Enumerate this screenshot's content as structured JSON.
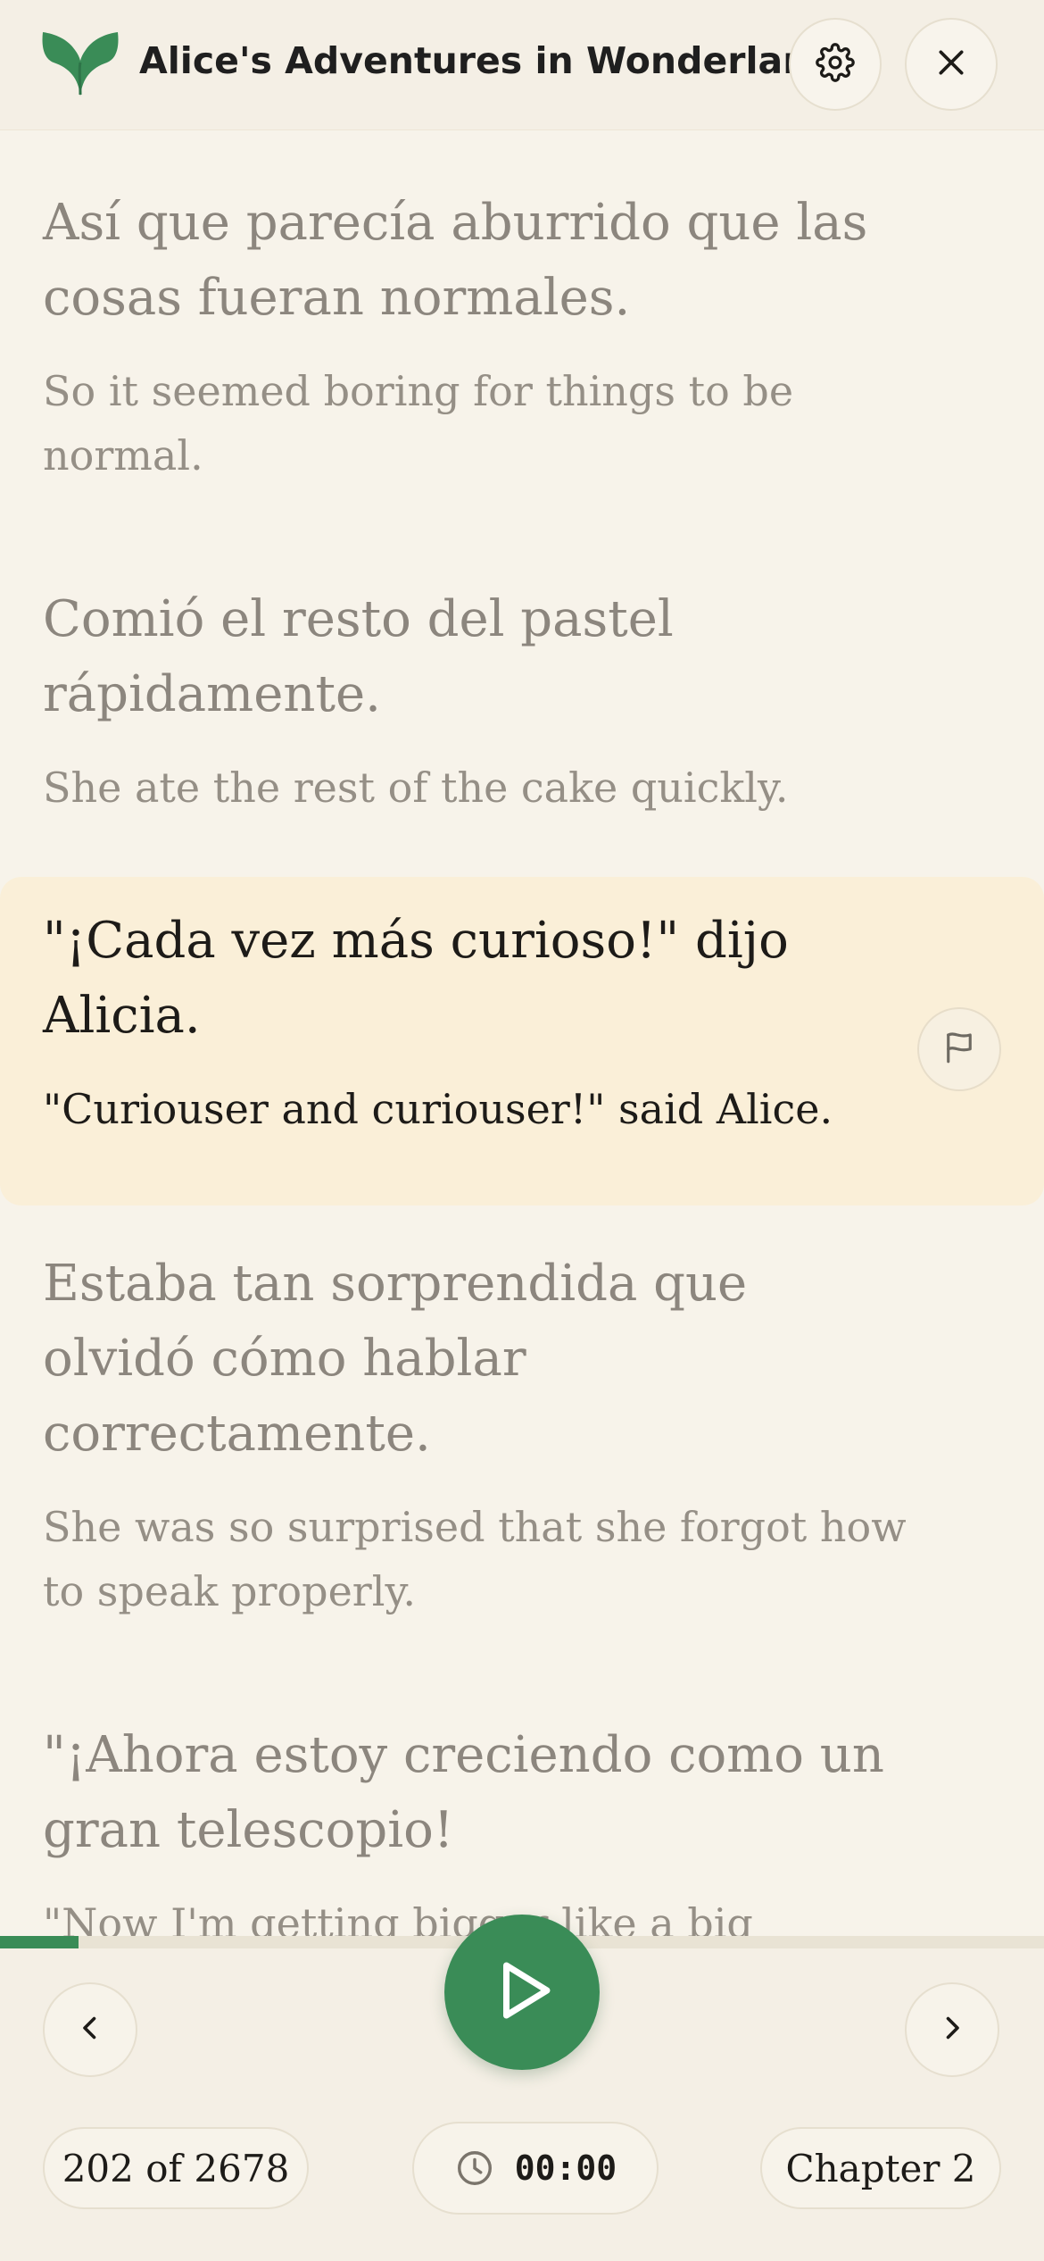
{
  "header": {
    "book_title": "Alice's Adventures in Wonderland",
    "logo_icon": "green-leaf-logo-icon",
    "settings_icon": "gear-icon",
    "close_icon": "close-icon"
  },
  "sentences": [
    {
      "spanish": "Así que parecía aburrido que las cosas fueran normales.",
      "english": "So it seemed boring for things to be normal.",
      "active": false
    },
    {
      "spanish": "Comió el resto del pastel rápidamente.",
      "english": "She ate the rest of the cake quickly.",
      "active": false
    },
    {
      "spanish": "\"¡Cada vez más curioso!\" dijo Alicia.",
      "english": "\"Curiouser and curiouser!\" said Alice.",
      "active": true,
      "flag_icon": "flag-icon"
    },
    {
      "spanish": "Estaba tan sorprendida que olvidó cómo hablar correctamente.",
      "english": "She was so surprised that she forgot how to speak properly.",
      "active": false
    },
    {
      "spanish": "\"¡Ahora estoy creciendo como un gran telescopio!",
      "english": "\"Now I'm getting bigger like a big",
      "active": false
    }
  ],
  "progress": {
    "fraction": 0.0754
  },
  "player": {
    "prev_icon": "chevron-left-icon",
    "play_icon": "play-icon",
    "next_icon": "chevron-right-icon",
    "position_text": "202 of 2678",
    "timer_icon": "clock-icon",
    "timer_text": "00:00",
    "chapter_text": "Chapter 2"
  },
  "colors": {
    "background": "#f7f3ea",
    "accent_green": "#3a8c57",
    "highlight": "#faefd8",
    "muted_text": "#8c867e",
    "active_text": "#1d1b18"
  }
}
